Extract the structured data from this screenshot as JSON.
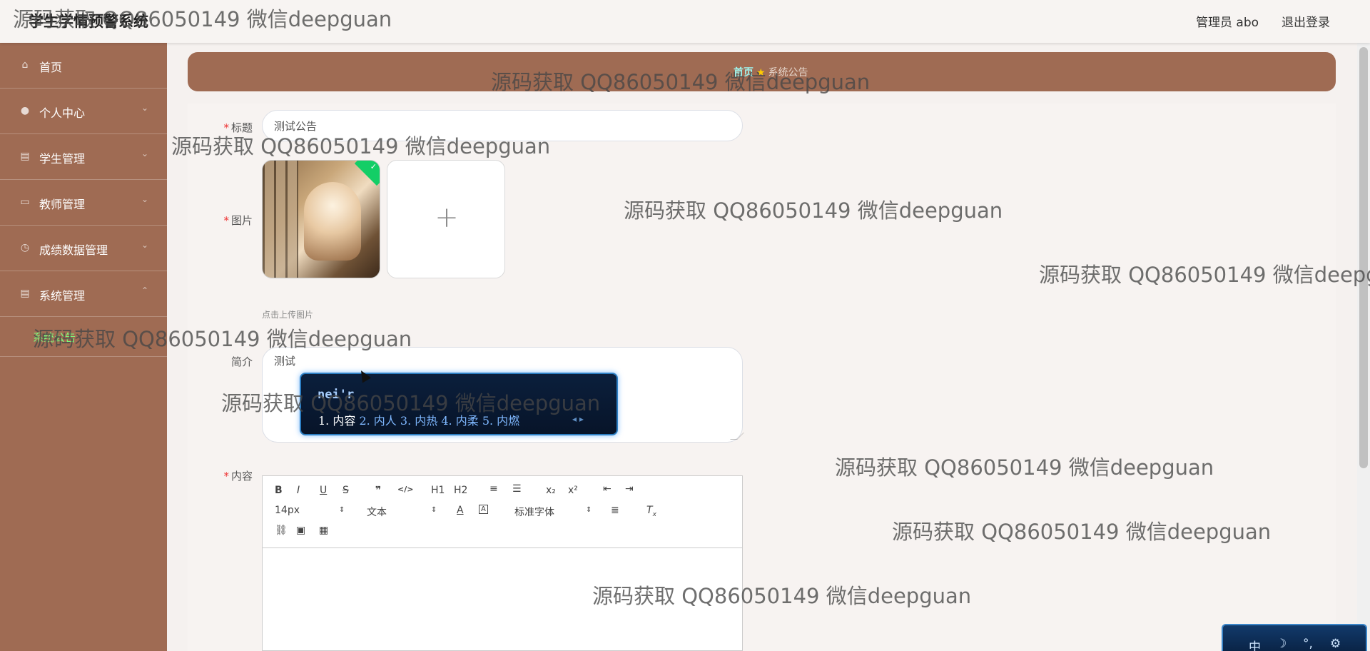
{
  "header": {
    "app_title": "学生学情预警系统",
    "user_label": "管理员 abo",
    "logout_label": "退出登录"
  },
  "sidebar": {
    "items": [
      {
        "label": "首页",
        "icon": "home-icon"
      },
      {
        "label": "个人中心",
        "icon": "user-icon"
      },
      {
        "label": "学生管理",
        "icon": "clipboard-icon"
      },
      {
        "label": "教师管理",
        "icon": "id-card-icon"
      },
      {
        "label": "成绩数据管理",
        "icon": "compass-icon"
      },
      {
        "label": "系统管理",
        "icon": "clipboard-icon"
      }
    ],
    "sub_item": "系统公告"
  },
  "breadcrumb": {
    "home": "首页",
    "current": "系统公告"
  },
  "form": {
    "title_label": "标题",
    "title_value": "测试公告",
    "image_label": "图片",
    "upload_tip": "点击上传图片",
    "intro_label": "简介",
    "intro_value": "测试",
    "content_label": "内容"
  },
  "editor": {
    "font_size": "14px",
    "block_type": "文本",
    "font_family": "标准字体",
    "buttons": [
      "B",
      "I",
      "U",
      "S",
      "❞",
      "</>",
      "H1",
      "H2",
      "ordered-list",
      "bullet-list",
      "x₂",
      "x²",
      "outdent",
      "indent",
      "A",
      "highlight",
      "align-left",
      "clear-format",
      "link",
      "image",
      "video"
    ]
  },
  "ime": {
    "input": "nei'r",
    "candidates": [
      "1. 内容",
      "2. 内人",
      "3. 内热",
      "4. 内柔",
      "5. 内燃"
    ],
    "status": [
      "中",
      "☽",
      "°,",
      "⚙"
    ]
  },
  "watermark": "源码获取 QQ86050149 微信deepguan"
}
